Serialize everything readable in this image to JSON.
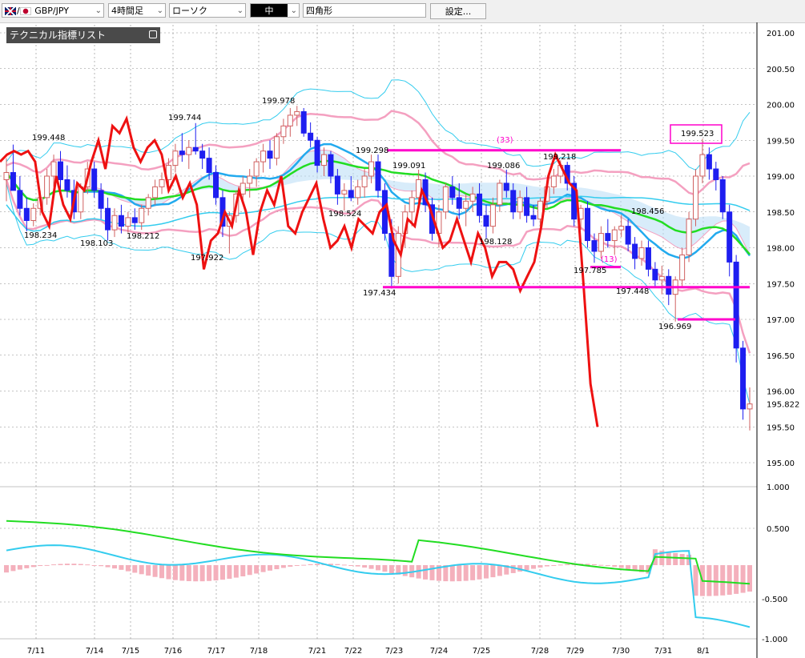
{
  "toolbar": {
    "symbol": "GBP/JPY",
    "timeframe": "4時間足",
    "chart_style": "ローソク",
    "tool_option": "中",
    "tool_name": "四角形",
    "settings_label": "設定..."
  },
  "panel": {
    "tech_list_label": "テクニカル指標リスト"
  },
  "colors": {
    "up_candle": "#f08a8a",
    "down_candle": "#1e1ef0",
    "rsi_red": "#ee1111",
    "ma_green": "#22dd22",
    "ma_blue": "#22aaee",
    "bollinger_pink": "#f4a0c0",
    "band_cyan": "#33ccee",
    "magenta": "#ff00cc"
  },
  "chart_data": {
    "type": "candlestick",
    "x_tick_labels": [
      "7/11",
      "7/14",
      "7/15",
      "7/16",
      "7/17",
      "7/18",
      "7/21",
      "7/22",
      "7/23",
      "7/24",
      "7/25",
      "7/28",
      "7/29",
      "7/30",
      "7/31",
      "8/1"
    ],
    "y_tick_labels": [
      "201.00",
      "200.50",
      "200.00",
      "199.50",
      "199.00",
      "198.50",
      "198.00",
      "197.50",
      "197.00",
      "196.50",
      "196.00",
      "195.50",
      "195.00"
    ],
    "ylim": [
      195.0,
      201.0
    ],
    "current_price": "195.822",
    "annotations": [
      "199.448",
      "198.234",
      "198.103",
      "198.212",
      "199.744",
      "197.922",
      "199.978",
      "199.298",
      "198.524",
      "197.434",
      "199.091",
      "198.128",
      "199.086",
      "199.218",
      "197.785",
      "198.456",
      "197.448",
      "196.969",
      "199.523",
      "(33)",
      "(13)"
    ],
    "horizontal_lines": [
      {
        "y": 199.36,
        "x_from": "7/23",
        "x_to": "7/30"
      },
      {
        "y": 197.45,
        "x_from": "7/23",
        "x_to": "8/1"
      },
      {
        "y": 197.73,
        "x_from": "7/29",
        "x_to": "7/30"
      },
      {
        "y": 197.0,
        "x_from": "7/31",
        "x_to": "8/1"
      }
    ],
    "candles": [
      {
        "o": 198.95,
        "h": 199.25,
        "l": 198.65,
        "c": 199.05
      },
      {
        "o": 199.05,
        "h": 199.44,
        "l": 198.9,
        "c": 198.8
      },
      {
        "o": 198.8,
        "h": 199.0,
        "l": 198.45,
        "c": 198.55
      },
      {
        "o": 198.55,
        "h": 198.7,
        "l": 198.23,
        "c": 198.38
      },
      {
        "o": 198.38,
        "h": 198.62,
        "l": 198.3,
        "c": 198.55
      },
      {
        "o": 198.55,
        "h": 198.8,
        "l": 198.45,
        "c": 198.7
      },
      {
        "o": 198.7,
        "h": 199.1,
        "l": 198.6,
        "c": 199.0
      },
      {
        "o": 199.0,
        "h": 199.3,
        "l": 198.85,
        "c": 199.2
      },
      {
        "o": 199.2,
        "h": 199.35,
        "l": 198.8,
        "c": 198.95
      },
      {
        "o": 198.95,
        "h": 199.15,
        "l": 198.7,
        "c": 198.8
      },
      {
        "o": 198.8,
        "h": 198.95,
        "l": 198.4,
        "c": 198.5
      },
      {
        "o": 198.5,
        "h": 198.9,
        "l": 198.4,
        "c": 198.85
      },
      {
        "o": 198.85,
        "h": 199.2,
        "l": 198.75,
        "c": 199.1
      },
      {
        "o": 199.1,
        "h": 199.2,
        "l": 198.7,
        "c": 198.8
      },
      {
        "o": 198.8,
        "h": 198.9,
        "l": 198.4,
        "c": 198.55
      },
      {
        "o": 198.55,
        "h": 198.7,
        "l": 198.1,
        "c": 198.25
      },
      {
        "o": 198.25,
        "h": 198.55,
        "l": 198.15,
        "c": 198.45
      },
      {
        "o": 198.45,
        "h": 198.6,
        "l": 198.2,
        "c": 198.3
      },
      {
        "o": 198.3,
        "h": 198.5,
        "l": 198.21,
        "c": 198.42
      },
      {
        "o": 198.42,
        "h": 198.55,
        "l": 198.25,
        "c": 198.35
      },
      {
        "o": 198.35,
        "h": 198.6,
        "l": 198.25,
        "c": 198.55
      },
      {
        "o": 198.55,
        "h": 198.75,
        "l": 198.45,
        "c": 198.7
      },
      {
        "o": 198.7,
        "h": 198.95,
        "l": 198.6,
        "c": 198.85
      },
      {
        "o": 198.85,
        "h": 199.05,
        "l": 198.75,
        "c": 198.95
      },
      {
        "o": 198.95,
        "h": 199.25,
        "l": 198.85,
        "c": 199.15
      },
      {
        "o": 199.15,
        "h": 199.45,
        "l": 199.05,
        "c": 199.35
      },
      {
        "o": 199.35,
        "h": 199.6,
        "l": 199.2,
        "c": 199.3
      },
      {
        "o": 199.3,
        "h": 199.5,
        "l": 199.1,
        "c": 199.4
      },
      {
        "o": 199.4,
        "h": 199.74,
        "l": 199.3,
        "c": 199.35
      },
      {
        "o": 199.35,
        "h": 199.45,
        "l": 199.1,
        "c": 199.25
      },
      {
        "o": 199.25,
        "h": 199.4,
        "l": 198.95,
        "c": 199.05
      },
      {
        "o": 199.05,
        "h": 199.15,
        "l": 198.6,
        "c": 198.7
      },
      {
        "o": 198.7,
        "h": 198.8,
        "l": 198.15,
        "c": 198.3
      },
      {
        "o": 198.3,
        "h": 198.5,
        "l": 197.92,
        "c": 198.45
      },
      {
        "o": 198.45,
        "h": 198.8,
        "l": 198.35,
        "c": 198.75
      },
      {
        "o": 198.75,
        "h": 199.0,
        "l": 198.6,
        "c": 198.9
      },
      {
        "o": 198.9,
        "h": 199.1,
        "l": 198.7,
        "c": 199.0
      },
      {
        "o": 199.0,
        "h": 199.25,
        "l": 198.85,
        "c": 199.2
      },
      {
        "o": 199.2,
        "h": 199.45,
        "l": 199.05,
        "c": 199.35
      },
      {
        "o": 199.35,
        "h": 199.5,
        "l": 199.1,
        "c": 199.25
      },
      {
        "o": 199.25,
        "h": 199.6,
        "l": 199.15,
        "c": 199.55
      },
      {
        "o": 199.55,
        "h": 199.8,
        "l": 199.45,
        "c": 199.7
      },
      {
        "o": 199.7,
        "h": 199.95,
        "l": 199.55,
        "c": 199.85
      },
      {
        "o": 199.85,
        "h": 199.98,
        "l": 199.7,
        "c": 199.9
      },
      {
        "o": 199.9,
        "h": 199.95,
        "l": 199.55,
        "c": 199.6
      },
      {
        "o": 199.6,
        "h": 199.75,
        "l": 199.4,
        "c": 199.5
      },
      {
        "o": 199.5,
        "h": 199.55,
        "l": 199.05,
        "c": 199.15
      },
      {
        "o": 199.15,
        "h": 199.4,
        "l": 199.0,
        "c": 199.3
      },
      {
        "o": 199.3,
        "h": 199.35,
        "l": 198.9,
        "c": 199.0
      },
      {
        "o": 199.0,
        "h": 199.1,
        "l": 198.6,
        "c": 198.75
      },
      {
        "o": 198.75,
        "h": 198.9,
        "l": 198.52,
        "c": 198.8
      },
      {
        "o": 198.8,
        "h": 199.0,
        "l": 198.65,
        "c": 198.7
      },
      {
        "o": 198.7,
        "h": 198.95,
        "l": 198.6,
        "c": 198.85
      },
      {
        "o": 198.85,
        "h": 199.1,
        "l": 198.7,
        "c": 199.0
      },
      {
        "o": 199.0,
        "h": 199.3,
        "l": 198.9,
        "c": 199.2
      },
      {
        "o": 199.2,
        "h": 199.3,
        "l": 198.7,
        "c": 198.8
      },
      {
        "o": 198.8,
        "h": 198.9,
        "l": 198.1,
        "c": 198.2
      },
      {
        "o": 198.2,
        "h": 198.4,
        "l": 197.43,
        "c": 197.6
      },
      {
        "o": 197.6,
        "h": 198.3,
        "l": 197.5,
        "c": 198.2
      },
      {
        "o": 198.2,
        "h": 198.6,
        "l": 198.0,
        "c": 198.5
      },
      {
        "o": 198.5,
        "h": 198.8,
        "l": 198.3,
        "c": 198.7
      },
      {
        "o": 198.7,
        "h": 199.09,
        "l": 198.6,
        "c": 198.95
      },
      {
        "o": 198.95,
        "h": 199.05,
        "l": 198.5,
        "c": 198.6
      },
      {
        "o": 198.6,
        "h": 198.7,
        "l": 198.1,
        "c": 198.2
      },
      {
        "o": 198.2,
        "h": 198.6,
        "l": 198.0,
        "c": 198.5
      },
      {
        "o": 198.5,
        "h": 198.9,
        "l": 198.4,
        "c": 198.85
      },
      {
        "o": 198.85,
        "h": 199.0,
        "l": 198.6,
        "c": 198.7
      },
      {
        "o": 198.7,
        "h": 198.9,
        "l": 198.4,
        "c": 198.55
      },
      {
        "o": 198.55,
        "h": 198.75,
        "l": 198.3,
        "c": 198.65
      },
      {
        "o": 198.65,
        "h": 198.85,
        "l": 198.5,
        "c": 198.75
      },
      {
        "o": 198.75,
        "h": 198.9,
        "l": 198.35,
        "c": 198.45
      },
      {
        "o": 198.45,
        "h": 198.6,
        "l": 198.13,
        "c": 198.3
      },
      {
        "o": 198.3,
        "h": 198.7,
        "l": 198.2,
        "c": 198.6
      },
      {
        "o": 198.6,
        "h": 198.95,
        "l": 198.5,
        "c": 198.9
      },
      {
        "o": 198.9,
        "h": 199.09,
        "l": 198.7,
        "c": 198.8
      },
      {
        "o": 198.8,
        "h": 198.9,
        "l": 198.4,
        "c": 198.5
      },
      {
        "o": 198.5,
        "h": 198.8,
        "l": 198.4,
        "c": 198.7
      },
      {
        "o": 198.7,
        "h": 198.85,
        "l": 198.35,
        "c": 198.45
      },
      {
        "o": 198.45,
        "h": 198.6,
        "l": 198.3,
        "c": 198.4
      },
      {
        "o": 198.4,
        "h": 198.7,
        "l": 198.3,
        "c": 198.65
      },
      {
        "o": 198.65,
        "h": 198.95,
        "l": 198.55,
        "c": 198.85
      },
      {
        "o": 198.85,
        "h": 199.1,
        "l": 198.75,
        "c": 199.0
      },
      {
        "o": 199.0,
        "h": 199.22,
        "l": 198.9,
        "c": 199.15
      },
      {
        "o": 199.15,
        "h": 199.2,
        "l": 198.8,
        "c": 198.9
      },
      {
        "o": 198.9,
        "h": 199.0,
        "l": 198.3,
        "c": 198.4
      },
      {
        "o": 198.4,
        "h": 198.6,
        "l": 198.25,
        "c": 198.55
      },
      {
        "o": 198.55,
        "h": 198.65,
        "l": 198.0,
        "c": 198.1
      },
      {
        "o": 198.1,
        "h": 198.2,
        "l": 197.79,
        "c": 197.95
      },
      {
        "o": 197.95,
        "h": 198.3,
        "l": 197.85,
        "c": 198.2
      },
      {
        "o": 198.2,
        "h": 198.4,
        "l": 198.0,
        "c": 198.1
      },
      {
        "o": 198.1,
        "h": 198.3,
        "l": 197.9,
        "c": 198.25
      },
      {
        "o": 198.25,
        "h": 198.46,
        "l": 198.15,
        "c": 198.3
      },
      {
        "o": 198.3,
        "h": 198.4,
        "l": 197.95,
        "c": 198.05
      },
      {
        "o": 198.05,
        "h": 198.15,
        "l": 197.7,
        "c": 197.85
      },
      {
        "o": 197.85,
        "h": 198.1,
        "l": 197.75,
        "c": 198.0
      },
      {
        "o": 198.0,
        "h": 198.1,
        "l": 197.6,
        "c": 197.7
      },
      {
        "o": 197.7,
        "h": 197.8,
        "l": 197.45,
        "c": 197.55
      },
      {
        "o": 197.55,
        "h": 197.75,
        "l": 197.35,
        "c": 197.6
      },
      {
        "o": 197.6,
        "h": 197.7,
        "l": 197.2,
        "c": 197.35
      },
      {
        "o": 197.35,
        "h": 197.6,
        "l": 196.97,
        "c": 197.55
      },
      {
        "o": 197.55,
        "h": 198.0,
        "l": 197.45,
        "c": 197.9
      },
      {
        "o": 197.9,
        "h": 198.5,
        "l": 197.8,
        "c": 198.4
      },
      {
        "o": 198.4,
        "h": 199.1,
        "l": 198.3,
        "c": 199.0
      },
      {
        "o": 199.0,
        "h": 199.52,
        "l": 198.9,
        "c": 199.3
      },
      {
        "o": 199.3,
        "h": 199.4,
        "l": 198.95,
        "c": 199.1
      },
      {
        "o": 199.1,
        "h": 199.2,
        "l": 198.8,
        "c": 198.95
      },
      {
        "o": 198.95,
        "h": 199.0,
        "l": 198.4,
        "c": 198.5
      },
      {
        "o": 198.5,
        "h": 198.6,
        "l": 197.6,
        "c": 197.8
      },
      {
        "o": 197.8,
        "h": 197.9,
        "l": 196.4,
        "c": 196.6
      },
      {
        "o": 196.6,
        "h": 196.7,
        "l": 195.6,
        "c": 195.75
      },
      {
        "o": 195.75,
        "h": 196.05,
        "l": 195.45,
        "c": 195.82
      }
    ],
    "rsi_line": [
      199.2,
      199.3,
      199.35,
      199.3,
      199.35,
      199.2,
      198.5,
      198.3,
      199.0,
      198.6,
      198.4,
      198.9,
      198.8,
      199.2,
      199.5,
      199.1,
      199.7,
      199.6,
      199.8,
      199.4,
      199.2,
      199.4,
      199.5,
      199.3,
      198.8,
      199.0,
      198.7,
      198.9,
      198.6,
      197.7,
      198.1,
      198.2,
      198.5,
      198.3,
      198.8,
      198.5,
      197.9,
      198.5,
      198.8,
      198.6,
      199.0,
      198.3,
      198.2,
      198.5,
      198.7,
      198.9,
      198.4,
      198.0,
      198.1,
      198.3,
      198.0,
      198.4,
      198.3,
      198.2,
      198.5,
      198.6,
      198.1,
      197.9,
      198.4,
      198.3,
      198.8,
      198.6,
      198.3,
      198.0,
      198.1,
      198.4,
      198.1,
      197.8,
      198.2,
      198.0,
      197.6,
      197.8,
      197.8,
      197.7,
      197.4,
      197.6,
      197.8,
      198.3,
      199.0,
      199.3,
      199.1,
      198.9,
      198.8,
      197.5,
      196.1,
      195.5
    ]
  }
}
